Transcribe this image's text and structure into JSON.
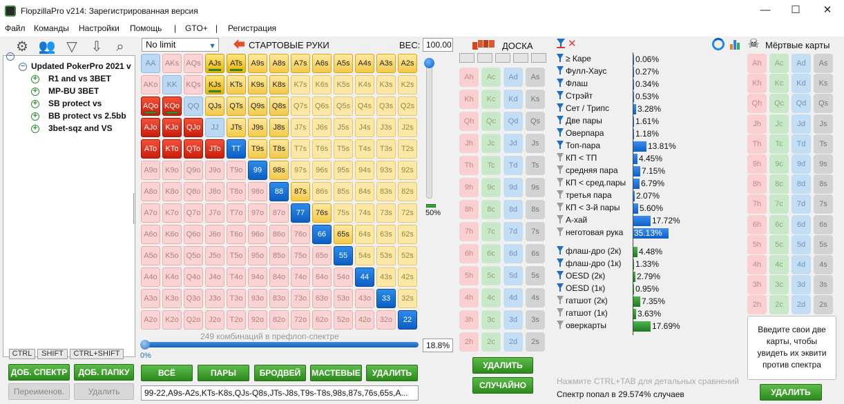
{
  "window": {
    "title": "FlopzillaPro v214: Зарегистрированная версия",
    "min": "—",
    "max": "☐",
    "close": "✕"
  },
  "menu": [
    "Файл",
    "Команды",
    "Настройки",
    "Помощь",
    "|",
    "GTO+",
    "|",
    "Регистрация"
  ],
  "tree": {
    "root": "Updated PokerPro 2021 v",
    "children": [
      "R1 and vs 3BET",
      "MP-BU 3BET",
      "SB protect vs",
      "BB protect vs 2.5bb",
      "3bet-sqz and VS"
    ]
  },
  "kbtabs": [
    "CTRL",
    "SHIFT",
    "CTRL+SHIFT"
  ],
  "left_buttons": {
    "add_range": "ДОБ. СПЕКТР",
    "add_folder": "ДОБ. ПАПКУ",
    "rename": "Переименов.",
    "delete": "Удалить"
  },
  "range": {
    "game": "No limit",
    "title": "СТАРТОВЫЕ РУКИ",
    "weight_label": "ВЕС:",
    "weight": "100.00",
    "slider_pct": "50%",
    "combos": "249 комбинаций в префлоп-спектре",
    "pct": "18.8%",
    "zero": "0%",
    "text": "99-22,A9s-A2s,KTs-K8s,QJs-Q8s,JTs-J8s,T9s-T8s,98s,87s,76s,65s,A..."
  },
  "range_buttons": [
    "ВСЁ",
    "ПАРЫ",
    "БРОДВЕЙ",
    "МАСТЕВЫЕ",
    "УДАЛИТЬ"
  ],
  "grid": [
    [
      "AA",
      "AKs",
      "AQs",
      "AJs",
      "ATs",
      "A9s",
      "A8s",
      "A7s",
      "A6s",
      "A5s",
      "A4s",
      "A3s",
      "A2s"
    ],
    [
      "AKo",
      "KK",
      "KQs",
      "KJs",
      "KTs",
      "K9s",
      "K8s",
      "K7s",
      "K6s",
      "K5s",
      "K4s",
      "K3s",
      "K2s"
    ],
    [
      "AQo",
      "KQo",
      "QQ",
      "QJs",
      "QTs",
      "Q9s",
      "Q8s",
      "Q7s",
      "Q6s",
      "Q5s",
      "Q4s",
      "Q3s",
      "Q2s"
    ],
    [
      "AJo",
      "KJo",
      "QJo",
      "JJ",
      "JTs",
      "J9s",
      "J8s",
      "J7s",
      "J6s",
      "J5s",
      "J4s",
      "J3s",
      "J2s"
    ],
    [
      "ATo",
      "KTo",
      "QTo",
      "JTo",
      "TT",
      "T9s",
      "T8s",
      "T7s",
      "T6s",
      "T5s",
      "T4s",
      "T3s",
      "T2s"
    ],
    [
      "A9o",
      "K9o",
      "Q9o",
      "J9o",
      "T9o",
      "99",
      "98s",
      "97s",
      "96s",
      "95s",
      "94s",
      "93s",
      "92s"
    ],
    [
      "A8o",
      "K8o",
      "Q8o",
      "J8o",
      "T8o",
      "98o",
      "88",
      "87s",
      "86s",
      "85s",
      "84s",
      "83s",
      "82s"
    ],
    [
      "A7o",
      "K7o",
      "Q7o",
      "J7o",
      "T7o",
      "97o",
      "87o",
      "77",
      "76s",
      "75s",
      "74s",
      "73s",
      "72s"
    ],
    [
      "A6o",
      "K6o",
      "Q6o",
      "J6o",
      "T6o",
      "96o",
      "86o",
      "76o",
      "66",
      "65s",
      "64s",
      "63s",
      "62s"
    ],
    [
      "A5o",
      "K5o",
      "Q5o",
      "J5o",
      "T5o",
      "95o",
      "85o",
      "75o",
      "65o",
      "55",
      "54s",
      "53s",
      "52s"
    ],
    [
      "A4o",
      "K4o",
      "Q4o",
      "J4o",
      "T4o",
      "94o",
      "84o",
      "74o",
      "64o",
      "54o",
      "44",
      "43s",
      "42s"
    ],
    [
      "A3o",
      "K3o",
      "Q3o",
      "J3o",
      "T3o",
      "93o",
      "83o",
      "73o",
      "63o",
      "53o",
      "43o",
      "33",
      "32s"
    ],
    [
      "A2o",
      "K2o",
      "Q2o",
      "J2o",
      "T2o",
      "92o",
      "82o",
      "72o",
      "62o",
      "52o",
      "42o",
      "32o",
      "22"
    ]
  ],
  "grid_state": [
    "lb p p S S s s s s s s s s",
    "p lb p S s s s y y y y y y",
    "r r lb s s s s y y y y y y",
    "r r r lb s s s y y y y y y",
    "r r r r b s s y y y y y y",
    "p p p p p b s y y y y y y",
    "p p p p p p b s y y y y y",
    "p p p p p p p b s y y y y",
    "p p p p p p p p b s y y y",
    "p p p p p p p p p b y y y",
    "p p p p p p p p p p b y y",
    "p p p p p p p p p p p b y",
    "p p p p p p p p p p p p b"
  ],
  "board": {
    "title": "ДОСКА",
    "delete": "УДАЛИТЬ",
    "random": "СЛУЧАЙНО",
    "ranks": [
      "A",
      "K",
      "Q",
      "J",
      "T",
      "9",
      "8",
      "7",
      "6",
      "5",
      "4",
      "3",
      "2"
    ],
    "suits": [
      "h",
      "c",
      "d",
      "s"
    ]
  },
  "stats": {
    "made": [
      {
        "label": "≥ Каре",
        "value": "0.06%",
        "v": 0.06,
        "f": "blue"
      },
      {
        "label": "Фулл-Хаус",
        "value": "0.27%",
        "v": 0.27,
        "f": "blue"
      },
      {
        "label": "Флаш",
        "value": "0.34%",
        "v": 0.34,
        "f": "blue"
      },
      {
        "label": "Стрэйт",
        "value": "0.53%",
        "v": 0.53,
        "f": "blue"
      },
      {
        "label": "Сет / Трипс",
        "value": "3.28%",
        "v": 3.28,
        "f": "blue"
      },
      {
        "label": "Две пары",
        "value": "1.61%",
        "v": 1.61,
        "f": "blue"
      },
      {
        "label": "Оверпара",
        "value": "1.18%",
        "v": 1.18,
        "f": "blue"
      },
      {
        "label": "Топ-пара",
        "value": "13.81%",
        "v": 13.81,
        "f": "blue"
      },
      {
        "label": "КП < ТП",
        "value": "4.45%",
        "v": 4.45,
        "f": "grey"
      },
      {
        "label": "средняя пара",
        "value": "7.15%",
        "v": 7.15,
        "f": "grey"
      },
      {
        "label": "КП < сред.пары",
        "value": "6.79%",
        "v": 6.79,
        "f": "grey"
      },
      {
        "label": "третья пара",
        "value": "2.07%",
        "v": 2.07,
        "f": "grey"
      },
      {
        "label": "КП < 3-й пары",
        "value": "5.60%",
        "v": 5.6,
        "f": "grey"
      },
      {
        "label": "А-хай",
        "value": "17.72%",
        "v": 17.72,
        "f": "grey"
      },
      {
        "label": "неготовая рука",
        "value": "35.13%",
        "v": 35.13,
        "f": "grey"
      }
    ],
    "draws": [
      {
        "label": "флаш-дро (2к)",
        "value": "4.48%",
        "v": 4.48,
        "f": "blue"
      },
      {
        "label": "флаш-дро (1к)",
        "value": "1.33%",
        "v": 1.33,
        "f": "blue"
      },
      {
        "label": "OESD (2к)",
        "value": "2.79%",
        "v": 2.79,
        "f": "blue"
      },
      {
        "label": "OESD (1к)",
        "value": "0.95%",
        "v": 0.95,
        "f": "blue"
      },
      {
        "label": "гатшот (2к)",
        "value": "7.35%",
        "v": 7.35,
        "f": "grey"
      },
      {
        "label": "гатшот (1к)",
        "value": "3.63%",
        "v": 3.63,
        "f": "grey"
      },
      {
        "label": "оверкарты",
        "value": "17.69%",
        "v": 17.69,
        "f": "grey"
      }
    ]
  },
  "dead": {
    "title": "Мёртвые карты",
    "hint": "Введите свои две карты, чтобы увидеть их эквити против спектра",
    "delete": "УДАЛИТЬ"
  },
  "footer": {
    "tip": "Нажмите CTRL+TAB для детальных сравнений",
    "hit": "Спектр попал в 29.574% случаев"
  },
  "colors": {
    "accent_green": "#2c8a1d",
    "blue": "#0c5fc4",
    "red": "#c81e0c",
    "yellow": "#e6b300"
  }
}
